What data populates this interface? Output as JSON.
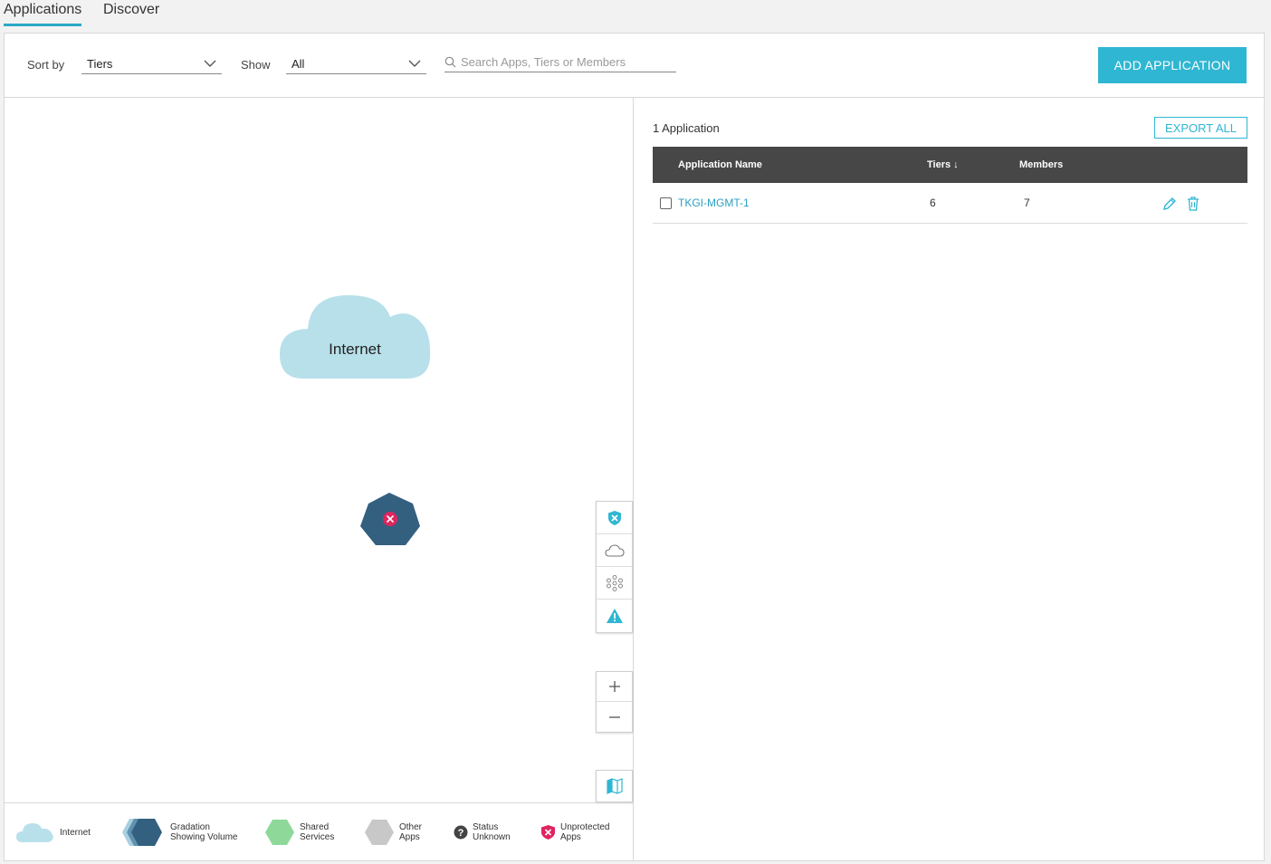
{
  "tabs": [
    {
      "label": "Applications",
      "active": true
    },
    {
      "label": "Discover",
      "active": false
    }
  ],
  "toolbar": {
    "sort_label": "Sort by",
    "sort_value": "Tiers",
    "show_label": "Show",
    "show_value": "All",
    "search_placeholder": "Search Apps, Tiers or Members",
    "add_button": "ADD APPLICATION"
  },
  "map": {
    "internet_label": "Internet"
  },
  "legend": {
    "internet": "Internet",
    "gradation_1": "Gradation",
    "gradation_2": "Showing Volume",
    "shared_1": "Shared",
    "shared_2": "Services",
    "other_1": "Other",
    "other_2": "Apps",
    "status_1": "Status",
    "status_2": "Unknown",
    "unprotected_1": "Unprotected",
    "unprotected_2": "Apps"
  },
  "list": {
    "count_text": "1 Application",
    "export_button": "EXPORT ALL",
    "columns": {
      "name": "Application Name",
      "tiers": "Tiers ↓",
      "members": "Members"
    },
    "rows": [
      {
        "name": "TKGI-MGMT-1",
        "tiers": "6",
        "members": "7"
      }
    ]
  },
  "colors": {
    "accent": "#2fb6d2",
    "internet_cloud": "#b8e0ea",
    "app_node": "#34607f",
    "alert_red": "#e0245e",
    "shared_green": "#8ed99a",
    "other_gray": "#c8c8c8"
  }
}
